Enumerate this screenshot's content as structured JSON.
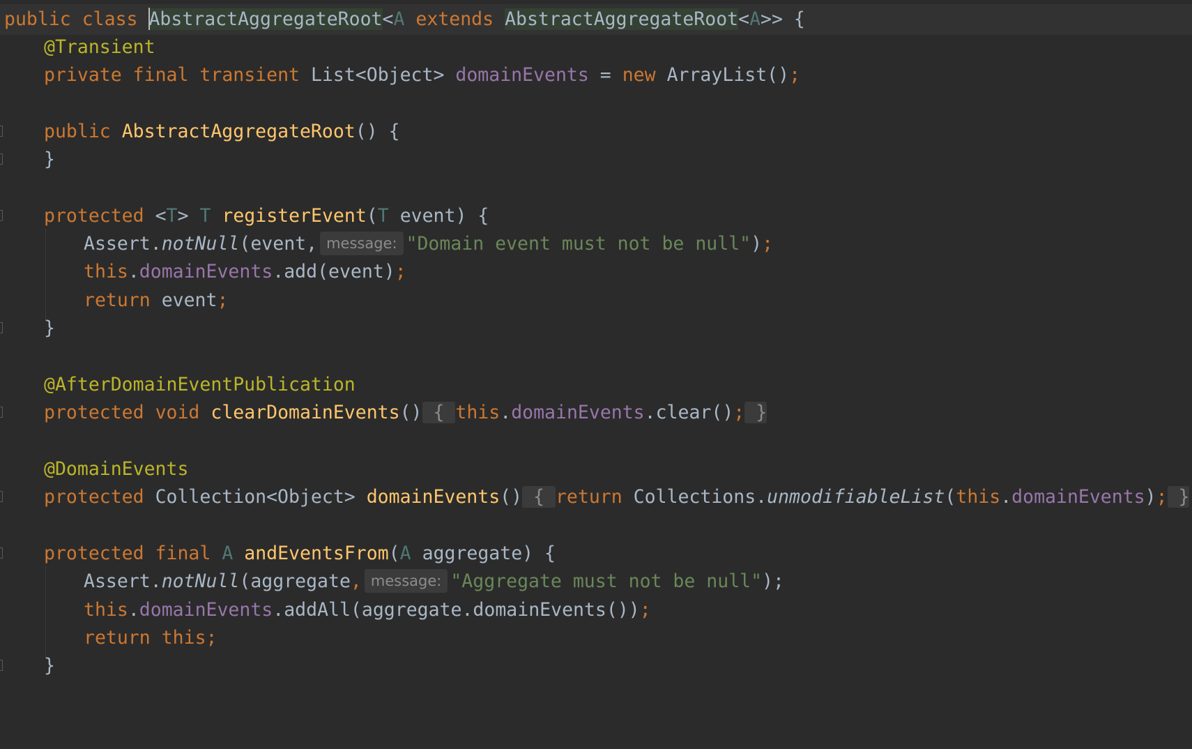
{
  "editor": {
    "class_decl": {
      "kw_public": "public",
      "kw_class": "class",
      "class_name": "AbstractAggregateRoot",
      "lt": "<",
      "type_param": "A",
      "kw_extends": "extends",
      "super_name": "AbstractAggregateRoot",
      "super_lt": "<",
      "super_param": "A",
      "close": ">> {"
    },
    "field_annotation": "@Transient",
    "field_decl": {
      "kw_private": "private",
      "kw_final": "final",
      "kw_transient": "transient",
      "type": "List<Object>",
      "name": "domainEvents",
      "assign": " = ",
      "kw_new": "new",
      "init": "ArrayList()",
      "semi": ";"
    },
    "ctor": {
      "kw_public": "public",
      "name": "AbstractAggregateRoot",
      "sig": "() {",
      "close": "}"
    },
    "register": {
      "kw_protected": "protected",
      "generic_open": "<",
      "generic_t": "T",
      "generic_close": ">",
      "ret_t": "T",
      "name": "registerEvent",
      "open_paren": "(",
      "param_t": "T",
      "param_rest": " event) {",
      "assert_obj": "Assert.",
      "assert_method": "notNull",
      "assert_args": "(event,",
      "hint": "message:",
      "assert_msg": "\"Domain event must not be null\"",
      "assert_end": ")",
      "semi": ";",
      "kw_this": "this",
      "dot": ".",
      "field": "domainEvents",
      "add_call": ".add(event)",
      "kw_return": "return",
      "ret_val": " event",
      "close": "}"
    },
    "clear_annotation": "@AfterDomainEventPublication",
    "clear": {
      "kw_protected": "protected",
      "kw_void": "void",
      "name": "clearDomainEvents",
      "parens": "()",
      "fold_open": " { ",
      "kw_this": "this",
      "dot": ".",
      "field": "domainEvents",
      "call": ".clear()",
      "semi": ";",
      "fold_close": " }"
    },
    "events_annotation": "@DomainEvents",
    "events": {
      "kw_protected": "protected",
      "type": "Collection<Object>",
      "name": "domainEvents",
      "parens": "()",
      "fold_open": " { ",
      "kw_return": "return",
      "obj": "Collections.",
      "method": "unmodifiableList",
      "open_paren": "(",
      "kw_this": "this",
      "dot": ".",
      "field": "domainEvents",
      "close_paren": ")",
      "semi": ";",
      "fold_close": " }"
    },
    "and_events": {
      "kw_protected": "protected",
      "kw_final": "final",
      "ret_t": "A",
      "name": "andEventsFrom",
      "open_paren": "(",
      "param_t": "A",
      "param_rest": " aggregate) {",
      "assert_obj": "Assert.",
      "assert_method": "notNull",
      "assert_args": "(aggregate",
      "comma": ",",
      "hint": "message:",
      "assert_msg": "\"Aggregate must not be null\"",
      "assert_end": ");",
      "kw_this": "this",
      "dot": ".",
      "field": "domainEvents",
      "addall_call": ".addAll(aggregate.domainEvents())",
      "semi": ";",
      "kw_return": "return",
      "kw_this_ret": "this",
      "ret_semi": ";",
      "close": "}"
    }
  }
}
